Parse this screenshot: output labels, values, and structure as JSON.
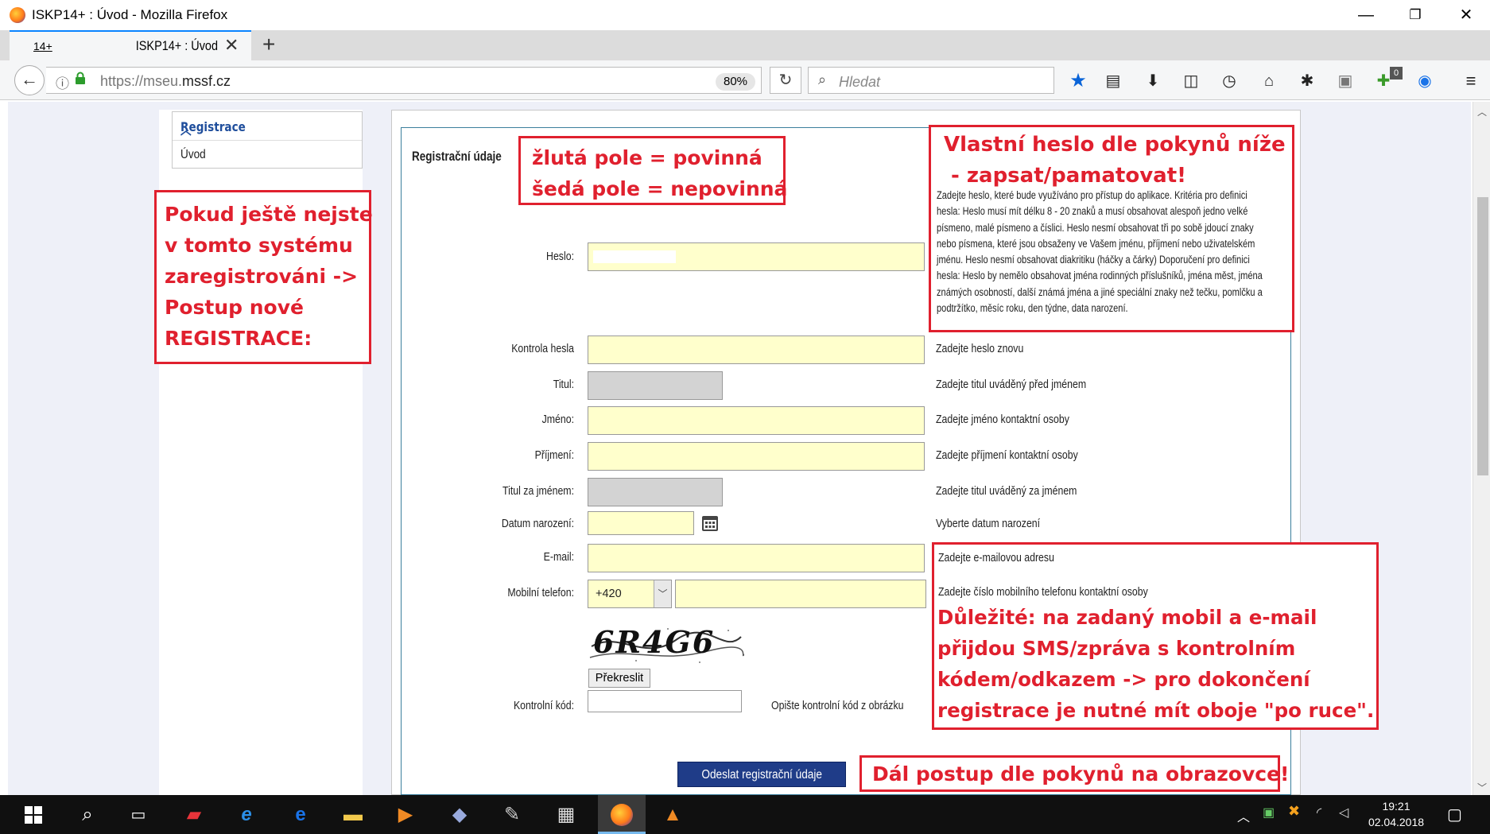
{
  "window": {
    "title": "ISKP14+ : Úvod - Mozilla Firefox",
    "controls": {
      "minimize": "—",
      "restore": "❐",
      "close": "✕"
    }
  },
  "tab": {
    "favicon": "14+",
    "label": "ISKP14+ : Úvod",
    "close": "✕",
    "new_tab": "+"
  },
  "nav": {
    "url_prefix": "https://mseu.",
    "url_domain": "mssf.cz",
    "zoom": "80%",
    "search_placeholder": "Hledat",
    "notification_count": "0"
  },
  "sidebar": {
    "header": "Registrace",
    "items": [
      {
        "label": "Úvod"
      }
    ]
  },
  "form": {
    "section_title": "Registrační údaje",
    "fields": {
      "password": {
        "label": "Heslo:"
      },
      "password_check": {
        "label": "Kontrola hesla",
        "help": "Zadejte heslo znovu"
      },
      "title_before": {
        "label": "Titul:",
        "help": "Zadejte titul uváděný před jménem"
      },
      "first_name": {
        "label": "Jméno:",
        "help": "Zadejte jméno kontaktní osoby"
      },
      "last_name": {
        "label": "Příjmení:",
        "help": "Zadejte příjmení kontaktní osoby"
      },
      "title_after": {
        "label": "Titul za jménem:",
        "help": "Zadejte titul uváděný za jménem"
      },
      "birth_date": {
        "label": "Datum narození:",
        "help": "Vyberte datum narození"
      },
      "email": {
        "label": "E-mail:",
        "help": "Zadejte e-mailovou adresu"
      },
      "mobile": {
        "label": "Mobilní telefon:",
        "prefix": "+420",
        "help": "Zadejte číslo mobilního telefonu kontaktní osoby"
      },
      "captcha": {
        "image_text": "6R4G6",
        "redraw": "Překreslit"
      },
      "control_code": {
        "label": "Kontrolní kód:",
        "help": "Opište kontrolní kód z obrázku"
      }
    },
    "submit": "Odeslat registrační údaje"
  },
  "annotations": {
    "fields_legend": {
      "line1": "žlutá pole = povinná",
      "line2": "šedá pole = nepovinná"
    },
    "password_heading": {
      "line1": "Vlastní heslo dle pokynů níže",
      "line2": " - zapsat/pamatovat!"
    },
    "password_rules": "Zadejte heslo, které bude využíváno pro přístup do aplikace. Kritéria pro definici hesla: Heslo musí mít délku 8 - 20 znaků a musí obsahovat alespoň jedno velké písmeno, malé písmeno a číslici. Heslo nesmí obsahovat tři po sobě jdoucí znaky nebo písmena, které jsou obsaženy ve Vašem jménu, příjmení nebo uživatelském jménu. Heslo nesmí obsahovat diakritiku (háčky a čárky) Doporučení pro definici hesla: Heslo by nemělo obsahovat jména rodinných příslušníků, jména měst, jména známých osobností, další známá jména a jiné speciální znaky než tečku, pomlčku a podtržítko, měsíc roku, den týdne, data narození.",
    "register_note": {
      "line1": "Pokud ještě nejste",
      "line2": "v tomto systému",
      "line3": "zaregistrováni ->",
      "line4": "Postup nové",
      "line5": "REGISTRACE:"
    },
    "important_note": {
      "line1": "Důležité: na zadaný mobil a e-mail",
      "line2": "přijdou SMS/zpráva s kontrolním",
      "line3": "kódem/odkazem -> pro dokončení",
      "line4": "registrace je nutné mít oboje \"po ruce\"."
    },
    "next_steps": "Dál postup dle pokynů na obrazovce!"
  },
  "taskbar": {
    "time": "19:21",
    "date": "02.04.2018"
  },
  "colors": {
    "required_field": "#ffffcc",
    "optional_field": "#d3d3d3",
    "annotation_red": "#e0202e",
    "submit_blue": "#1f3c88"
  }
}
